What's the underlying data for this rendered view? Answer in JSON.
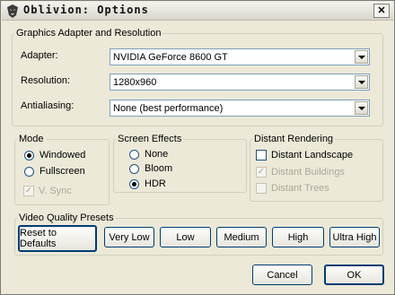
{
  "window": {
    "title": "Oblivion: Options",
    "close_symbol": "✕"
  },
  "graphics": {
    "legend": "Graphics Adapter and Resolution",
    "adapter": {
      "label": "Adapter:",
      "value": "NVIDIA GeForce 8600 GT"
    },
    "resolution": {
      "label": "Resolution:",
      "value": "1280x960"
    },
    "antialiasing": {
      "label": "Antialiasing:",
      "value": "None (best performance)"
    }
  },
  "mode": {
    "legend": "Mode",
    "windowed": {
      "label": "Windowed",
      "selected": true
    },
    "fullscreen": {
      "label": "Fullscreen",
      "selected": false
    },
    "vsync": {
      "label": "V. Sync",
      "checked": true,
      "enabled": false
    }
  },
  "effects": {
    "legend": "Screen Effects",
    "none": {
      "label": "None",
      "selected": false
    },
    "bloom": {
      "label": "Bloom",
      "selected": false
    },
    "hdr": {
      "label": "HDR",
      "selected": true
    }
  },
  "distant": {
    "legend": "Distant Rendering",
    "landscape": {
      "label": "Distant Landscape",
      "checked": false,
      "enabled": true
    },
    "buildings": {
      "label": "Distant Buildings",
      "checked": true,
      "enabled": false
    },
    "trees": {
      "label": "Distant Trees",
      "checked": false,
      "enabled": false
    }
  },
  "presets": {
    "legend": "Video Quality Presets",
    "reset": "Reset to Defaults",
    "very_low": "Very Low",
    "low": "Low",
    "medium": "Medium",
    "high": "High",
    "ultra_high": "Ultra High"
  },
  "footer": {
    "cancel": "Cancel",
    "ok": "OK"
  }
}
